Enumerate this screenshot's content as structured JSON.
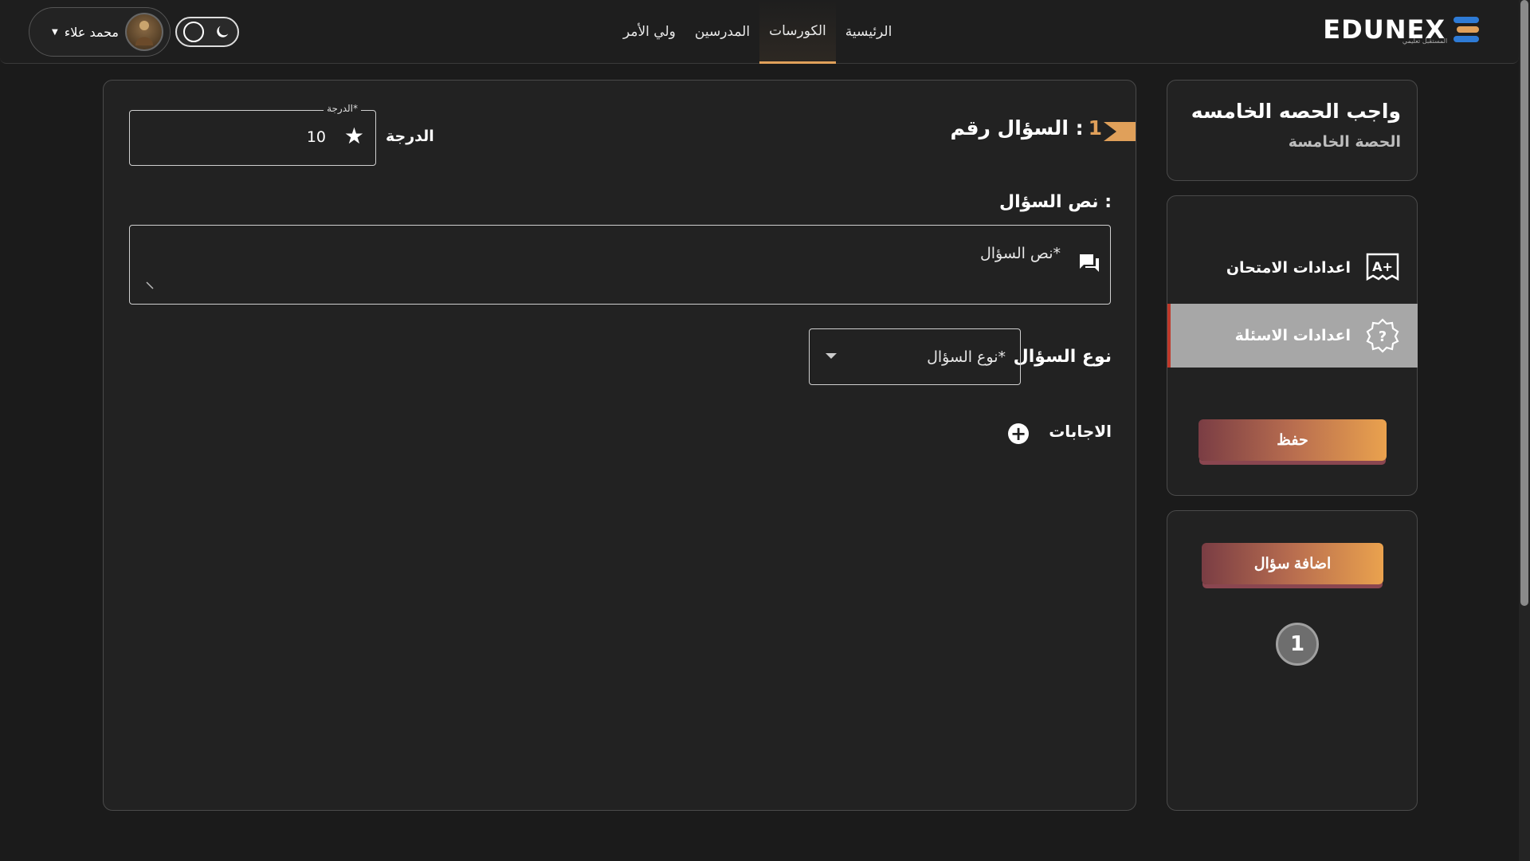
{
  "brand": {
    "name": "EDUNEX",
    "tagline": "المستقبل تعليمي"
  },
  "nav": {
    "links": [
      {
        "label": "الرئيسية",
        "active": false
      },
      {
        "label": "الكورسات",
        "active": true
      },
      {
        "label": "المدرسين",
        "active": false
      },
      {
        "label": "ولي الأمر",
        "active": false
      }
    ]
  },
  "user": {
    "name": "محمد علاء"
  },
  "sidebar": {
    "lesson": {
      "title": "واجب الحصه الخامسه",
      "subtitle": "الحصة الخامسة"
    },
    "menu": [
      {
        "label": "اعدادات الامتحان",
        "icon": "exam-grade-icon",
        "active": false
      },
      {
        "label": "اعدادات الاسئلة",
        "icon": "question-badge-icon",
        "active": true
      }
    ],
    "save_label": "حفظ",
    "add_question_label": "اضافة سؤال",
    "questions": [
      "1"
    ]
  },
  "question": {
    "heading": "السؤال رقم :",
    "number": "1",
    "grade_label": "الدرجة",
    "grade_field_label": "الدرجة*",
    "grade_value": "10",
    "text_label": "نص السؤال :",
    "text_placeholder": "نص السؤال*",
    "type_label": "نوع السؤال",
    "type_placeholder": "نوع السؤال*",
    "answers_label": "الاجابات"
  },
  "colors": {
    "accent": "#e0a05a",
    "background": "#1b1b1b",
    "panel": "#222222",
    "active_menu": "#a7a7a7"
  }
}
